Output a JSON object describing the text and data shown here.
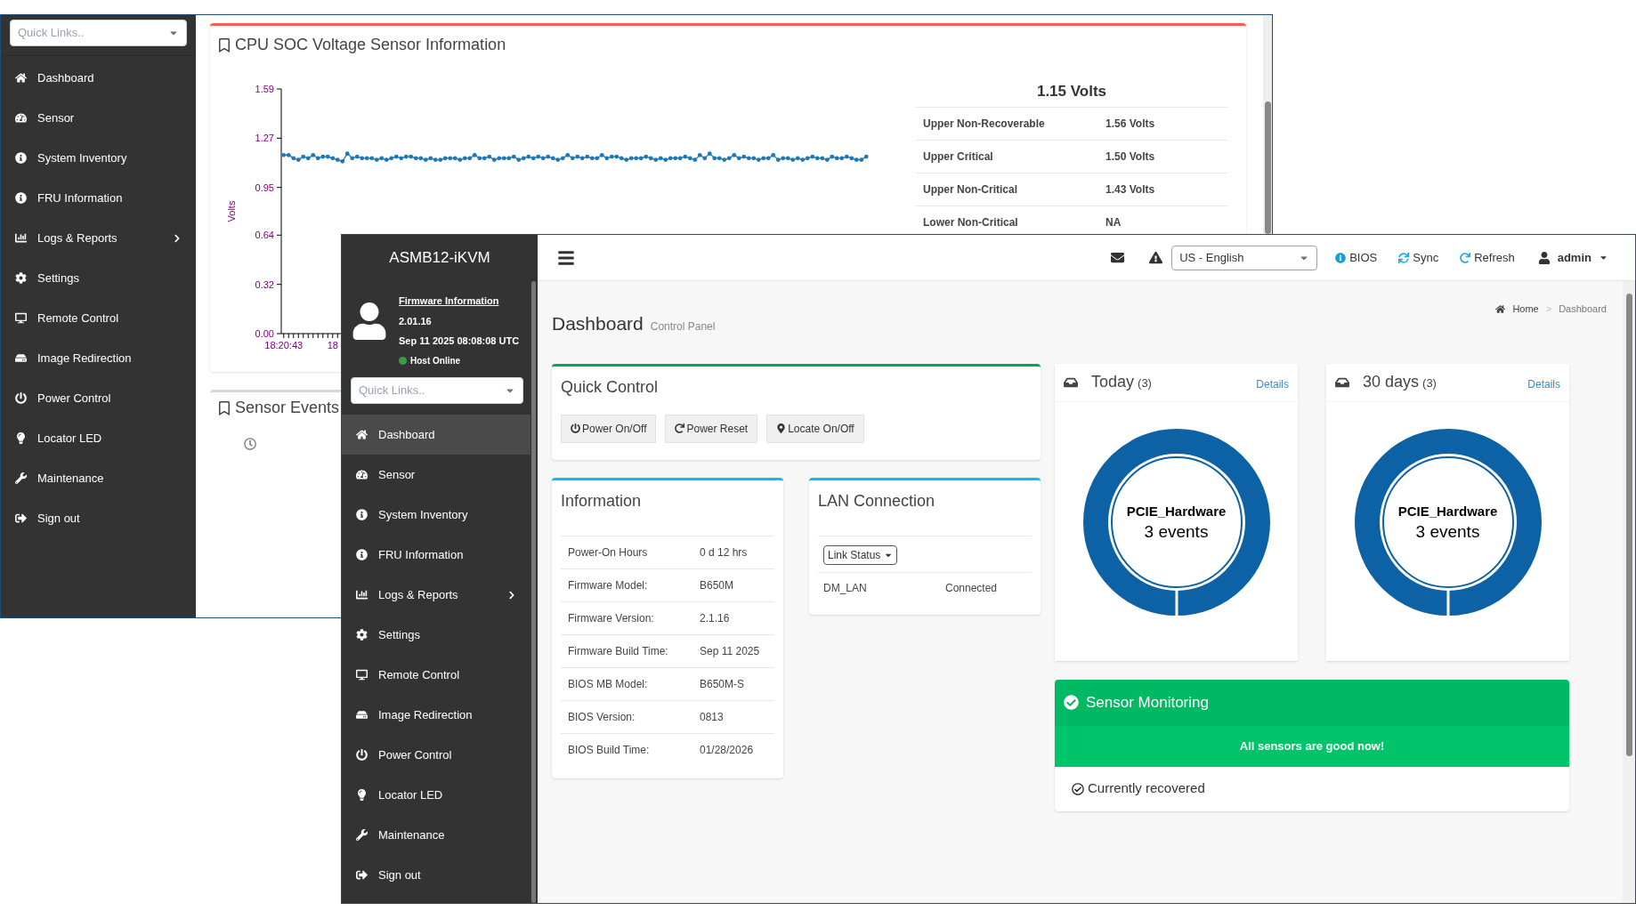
{
  "back_window": {
    "quick_links": {
      "placeholder": "Quick Links.."
    },
    "nav": [
      {
        "label": "Dashboard",
        "selected": false,
        "has_submenu": false
      },
      {
        "label": "Sensor",
        "selected": false,
        "has_submenu": false
      },
      {
        "label": "System Inventory",
        "selected": false,
        "has_submenu": false
      },
      {
        "label": "FRU Information",
        "selected": false,
        "has_submenu": false
      },
      {
        "label": "Logs & Reports",
        "selected": false,
        "has_submenu": true
      },
      {
        "label": "Settings",
        "selected": false,
        "has_submenu": false
      },
      {
        "label": "Remote Control",
        "selected": false,
        "has_submenu": false
      },
      {
        "label": "Image Redirection",
        "selected": false,
        "has_submenu": false
      },
      {
        "label": "Power Control",
        "selected": false,
        "has_submenu": false
      },
      {
        "label": "Locator LED",
        "selected": false,
        "has_submenu": false
      },
      {
        "label": "Maintenance",
        "selected": false,
        "has_submenu": false
      },
      {
        "label": "Sign out",
        "selected": false,
        "has_submenu": false
      }
    ],
    "sensor_card": {
      "title": "CPU SOC Voltage Sensor Information",
      "chart_data": {
        "type": "line",
        "ylabel": "Volts",
        "ylim": [
          0,
          1.59
        ],
        "yticks": [
          {
            "value": 0,
            "label": "0.00"
          },
          {
            "value": 0.32,
            "label": "0.32"
          },
          {
            "value": 0.64,
            "label": "0.64"
          },
          {
            "value": 0.95,
            "label": "0.95"
          },
          {
            "value": 1.27,
            "label": "1.27"
          },
          {
            "value": 1.59,
            "label": "1.59"
          }
        ],
        "categories": [
          "18:20:43",
          null,
          null,
          null,
          null,
          null,
          null,
          null,
          null,
          null,
          "18",
          null,
          null,
          null,
          null,
          null,
          null,
          null,
          null,
          null,
          null,
          null,
          null,
          null,
          null,
          null,
          null,
          null,
          null,
          null,
          null,
          null,
          null,
          null,
          null,
          null,
          null,
          null,
          null,
          null,
          null,
          null,
          null,
          null,
          null,
          null,
          null,
          null,
          null,
          null,
          null,
          null,
          null,
          null,
          null,
          null,
          null,
          null,
          null,
          null,
          null,
          null,
          null,
          null,
          null,
          null,
          null,
          null,
          null,
          null,
          null,
          null,
          null,
          null,
          null,
          null,
          null,
          null,
          null,
          null,
          null,
          null,
          null,
          null,
          null,
          null,
          null,
          null,
          null,
          null,
          null,
          null,
          null,
          null,
          null,
          null,
          null,
          null,
          null,
          null,
          null,
          null,
          null,
          null,
          null,
          null,
          null,
          null,
          null,
          null,
          null,
          null,
          null,
          null,
          null,
          null,
          null,
          null,
          null,
          null
        ],
        "series": [
          {
            "color": "#1f77b4",
            "values": [
              1.16,
              1.16,
              1.14,
              1.13,
              1.15,
              1.14,
              1.16,
              1.14,
              1.15,
              1.15,
              1.14,
              1.13,
              1.12,
              1.17,
              1.14,
              1.15,
              1.14,
              1.14,
              1.14,
              1.13,
              1.14,
              1.13,
              1.14,
              1.15,
              1.14,
              1.15,
              1.15,
              1.14,
              1.14,
              1.13,
              1.14,
              1.13,
              1.13,
              1.14,
              1.14,
              1.14,
              1.13,
              1.14,
              1.14,
              1.16,
              1.14,
              1.14,
              1.15,
              1.13,
              1.14,
              1.14,
              1.14,
              1.15,
              1.13,
              1.14,
              1.15,
              1.14,
              1.15,
              1.14,
              1.15,
              1.14,
              1.13,
              1.14,
              1.16,
              1.14,
              1.15,
              1.14,
              1.15,
              1.14,
              1.14,
              1.16,
              1.14,
              1.15,
              1.15,
              1.14,
              1.13,
              1.14,
              1.14,
              1.14,
              1.15,
              1.14,
              1.13,
              1.14,
              1.13,
              1.14,
              1.14,
              1.14,
              1.15,
              1.14,
              1.13,
              1.16,
              1.14,
              1.17,
              1.14,
              1.14,
              1.13,
              1.14,
              1.16,
              1.14,
              1.15,
              1.14,
              1.14,
              1.13,
              1.14,
              1.14,
              1.16,
              1.13,
              1.14,
              1.14,
              1.13,
              1.14,
              1.13,
              1.14,
              1.15,
              1.14,
              1.14,
              1.13,
              1.15,
              1.14,
              1.14,
              1.15,
              1.14,
              1.13,
              1.13,
              1.15
            ]
          }
        ]
      },
      "reading": "1.15 Volts",
      "thresholds": [
        {
          "label": "Upper Non-Recoverable",
          "value": "1.56 Volts"
        },
        {
          "label": "Upper Critical",
          "value": "1.50 Volts"
        },
        {
          "label": "Upper Non-Critical",
          "value": "1.43 Volts"
        },
        {
          "label": "Lower Non-Critical",
          "value": "NA"
        }
      ]
    },
    "events_card": {
      "title": "Sensor Events"
    }
  },
  "front_window": {
    "brand": "ASMB12-iKVM",
    "profile": {
      "link": "Firmware Information",
      "version": "2.01.16",
      "time": "Sep 11 2025 08:08:08 UTC",
      "host_status": "Host Online",
      "online": true
    },
    "quick_links": {
      "placeholder": "Quick Links.."
    },
    "nav": [
      {
        "label": "Dashboard",
        "selected": true,
        "has_submenu": false
      },
      {
        "label": "Sensor",
        "selected": false,
        "has_submenu": false
      },
      {
        "label": "System Inventory",
        "selected": false,
        "has_submenu": false
      },
      {
        "label": "FRU Information",
        "selected": false,
        "has_submenu": false
      },
      {
        "label": "Logs & Reports",
        "selected": false,
        "has_submenu": true
      },
      {
        "label": "Settings",
        "selected": false,
        "has_submenu": false
      },
      {
        "label": "Remote Control",
        "selected": false,
        "has_submenu": false
      },
      {
        "label": "Image Redirection",
        "selected": false,
        "has_submenu": false
      },
      {
        "label": "Power Control",
        "selected": false,
        "has_submenu": false
      },
      {
        "label": "Locator LED",
        "selected": false,
        "has_submenu": false
      },
      {
        "label": "Maintenance",
        "selected": false,
        "has_submenu": false
      },
      {
        "label": "Sign out",
        "selected": false,
        "has_submenu": false
      }
    ],
    "header": {
      "language": "US - English",
      "actions": [
        "BIOS",
        "Sync",
        "Refresh"
      ],
      "user": "admin"
    },
    "page": {
      "title": "Dashboard",
      "subtitle": "Control Panel",
      "breadcrumb": [
        "Home",
        "Dashboard"
      ],
      "breadcrumb_separator": ">"
    },
    "quick_control": {
      "title": "Quick Control",
      "buttons": [
        "Power On/Off",
        "Power Reset",
        "Locate On/Off"
      ]
    },
    "information": {
      "title": "Information",
      "rows": [
        {
          "label": "Power-On Hours",
          "value": "0 d 12 hrs"
        },
        {
          "label": "Firmware Model:",
          "value": "B650M"
        },
        {
          "label": "Firmware Version:",
          "value": "2.1.16"
        },
        {
          "label": "Firmware Build Time:",
          "value": "Sep 11 2025"
        },
        {
          "label": "BIOS MB Model:",
          "value": "B650M-S"
        },
        {
          "label": "BIOS Version:",
          "value": "0813"
        },
        {
          "label": "BIOS Build Time:",
          "value": "01/28/2026"
        }
      ]
    },
    "lan": {
      "title": "LAN Connection",
      "select": "Link Status",
      "rows": [
        {
          "name": "DM_LAN",
          "status": "Connected"
        }
      ]
    },
    "event_cards": [
      {
        "title": "Today",
        "count": "(3)",
        "link": "Details",
        "center_label": "PCIE_Hardware",
        "center_value": "3 events"
      },
      {
        "title": "30 days",
        "count": "(3)",
        "link": "Details",
        "center_label": "PCIE_Hardware",
        "center_value": "3 events"
      }
    ],
    "sensor_monitoring": {
      "title": "Sensor Monitoring",
      "message": "All sensors are good now!",
      "footer": "Currently recovered"
    }
  }
}
